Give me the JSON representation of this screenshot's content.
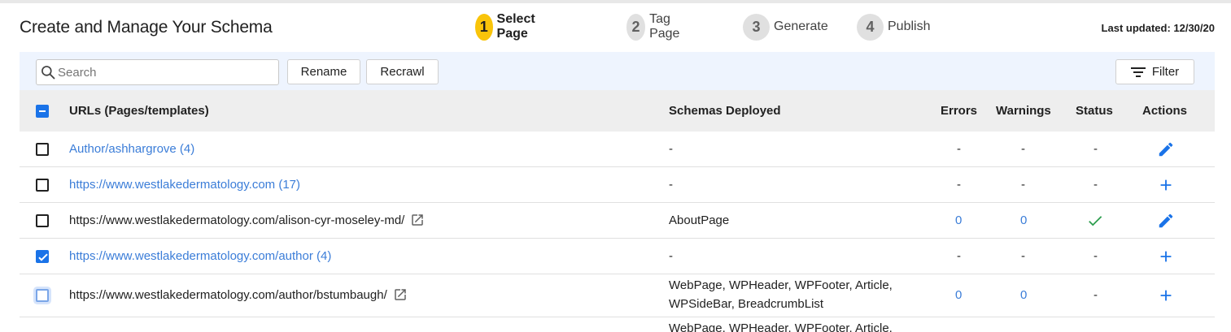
{
  "header": {
    "title": "Create and Manage Your Schema",
    "last_updated": "Last updated: 12/30/20",
    "steps": [
      {
        "num": "1",
        "label": "Select Page",
        "active": true
      },
      {
        "num": "2",
        "label": "Tag Page",
        "active": false
      },
      {
        "num": "3",
        "label": "Generate",
        "active": false
      },
      {
        "num": "4",
        "label": "Publish",
        "active": false
      }
    ]
  },
  "toolbar": {
    "search_placeholder": "Search",
    "rename_label": "Rename",
    "recrawl_label": "Recrawl",
    "filter_label": "Filter"
  },
  "table": {
    "columns": {
      "urls": "URLs (Pages/templates)",
      "schemas": "Schemas Deployed",
      "errors": "Errors",
      "warnings": "Warnings",
      "status": "Status",
      "actions": "Actions"
    },
    "rows": [
      {
        "url": "Author/ashhargrove (4)",
        "schemas": "-",
        "errors": "-",
        "warnings": "-",
        "status": "-"
      },
      {
        "url": "https://www.westlakedermatology.com (17)",
        "schemas": "-",
        "errors": "-",
        "warnings": "-",
        "status": "-"
      },
      {
        "url": "https://www.westlakedermatology.com/alison-cyr-moseley-md/",
        "schemas": "AboutPage",
        "errors": "0",
        "warnings": "0",
        "status": ""
      },
      {
        "url": "https://www.westlakedermatology.com/author (4)",
        "schemas": "-",
        "errors": "-",
        "warnings": "-",
        "status": "-"
      },
      {
        "url": "https://www.westlakedermatology.com/author/bstumbaugh/",
        "schemas_line1": "WebPage, WPHeader, WPFooter, Article,",
        "schemas_line2": "WPSideBar, BreadcrumbList",
        "errors": "0",
        "warnings": "0",
        "status": "-"
      },
      {
        "schemas": "WebPage, WPHeader, WPFooter, Article,"
      }
    ]
  },
  "colors": {
    "accent": "#3b7dd8",
    "active_step": "#f9c40a",
    "success": "#2e9e4f",
    "toolbar_bg": "#eef4fe"
  },
  "icons": {
    "search": "search-icon",
    "filter": "filter-icon",
    "edit": "pencil-icon",
    "add": "plus-icon",
    "external": "external-link-icon",
    "status_ok": "check-icon"
  }
}
